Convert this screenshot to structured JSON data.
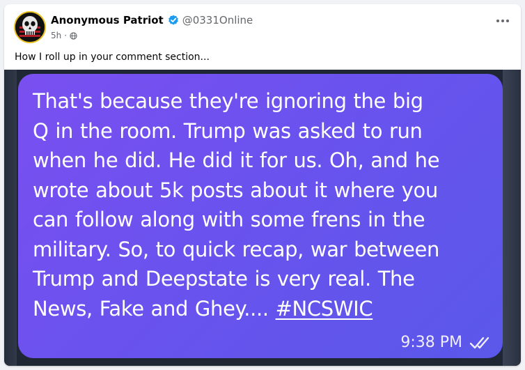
{
  "post": {
    "author_name": "Anonymous Patriot",
    "author_handle": "@0331Online",
    "time_ago": "5h",
    "meta_separator": "·",
    "privacy_icon": "globe-icon",
    "more_icon": "more-horizontal-icon",
    "caption": "How I roll up in your comment section..."
  },
  "image": {
    "message_lines": [
      "That's because they're ignoring the big",
      "Q in the room. Trump was asked to run",
      "when he did. He did it for us. Oh, and he",
      "wrote about 5k posts about it where you",
      "can follow along with some frens in the",
      "military. So, to quick recap, war between",
      "Trump and Deepstate is very real. The",
      "News, Fake and Ghey.... "
    ],
    "hashtag": "#NCSWIC",
    "timestamp": "9:38 PM",
    "read_icon": "double-check-icon"
  },
  "colors": {
    "verified_badge": "#1d9bf0",
    "bubble_start": "#7a4ff0",
    "bubble_end": "#5a58ea",
    "avatar_ring": "#e8c020"
  }
}
